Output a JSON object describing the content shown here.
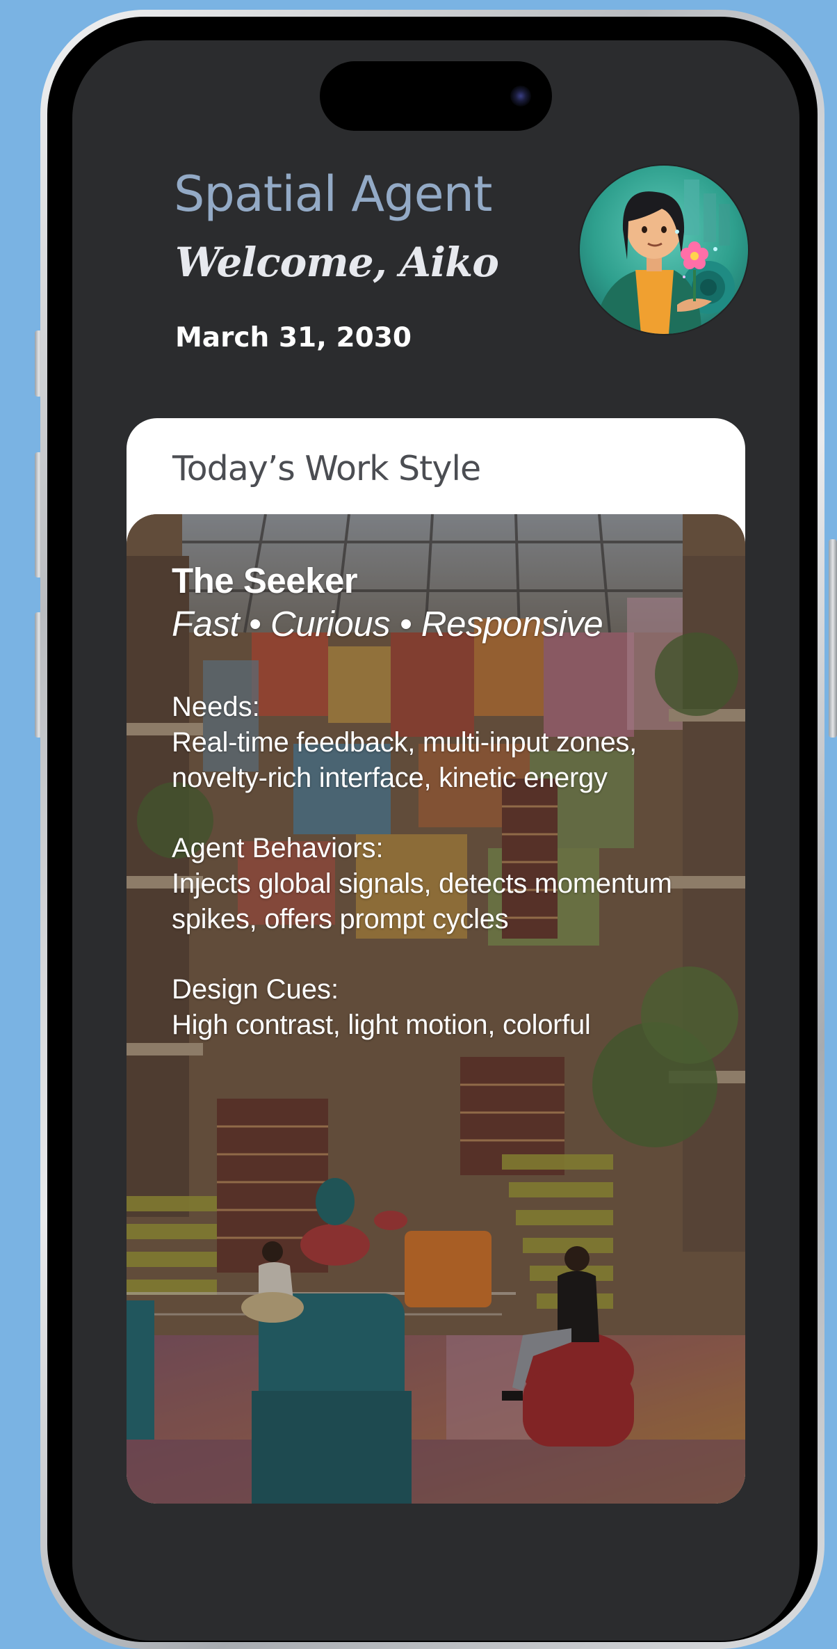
{
  "header": {
    "app_title": "Spatial Agent",
    "welcome": "Welcome, Aiko",
    "date": "March 31, 2030"
  },
  "avatar": {
    "icon": "user-avatar-illustration"
  },
  "card": {
    "heading": "Today’s Work Style",
    "persona_name": "The Seeker",
    "persona_traits": "Fast • Curious • Responsive",
    "sections": [
      {
        "label": "Needs:",
        "lines": [
          "Real-time feedback, multi-input zones,",
          "novelty-rich interface, kinetic energy"
        ]
      },
      {
        "label": "Agent Behaviors:",
        "lines": [
          "Injects global signals, detects momentum",
          "spikes, offers prompt cycles"
        ]
      },
      {
        "label": "Design Cues:",
        "lines": [
          "High contrast, light motion, colorful"
        ]
      }
    ]
  },
  "colors": {
    "background": "#7ab3e3",
    "screen": "#2b2c2e",
    "title": "#93aac6",
    "card": "#ffffff"
  }
}
